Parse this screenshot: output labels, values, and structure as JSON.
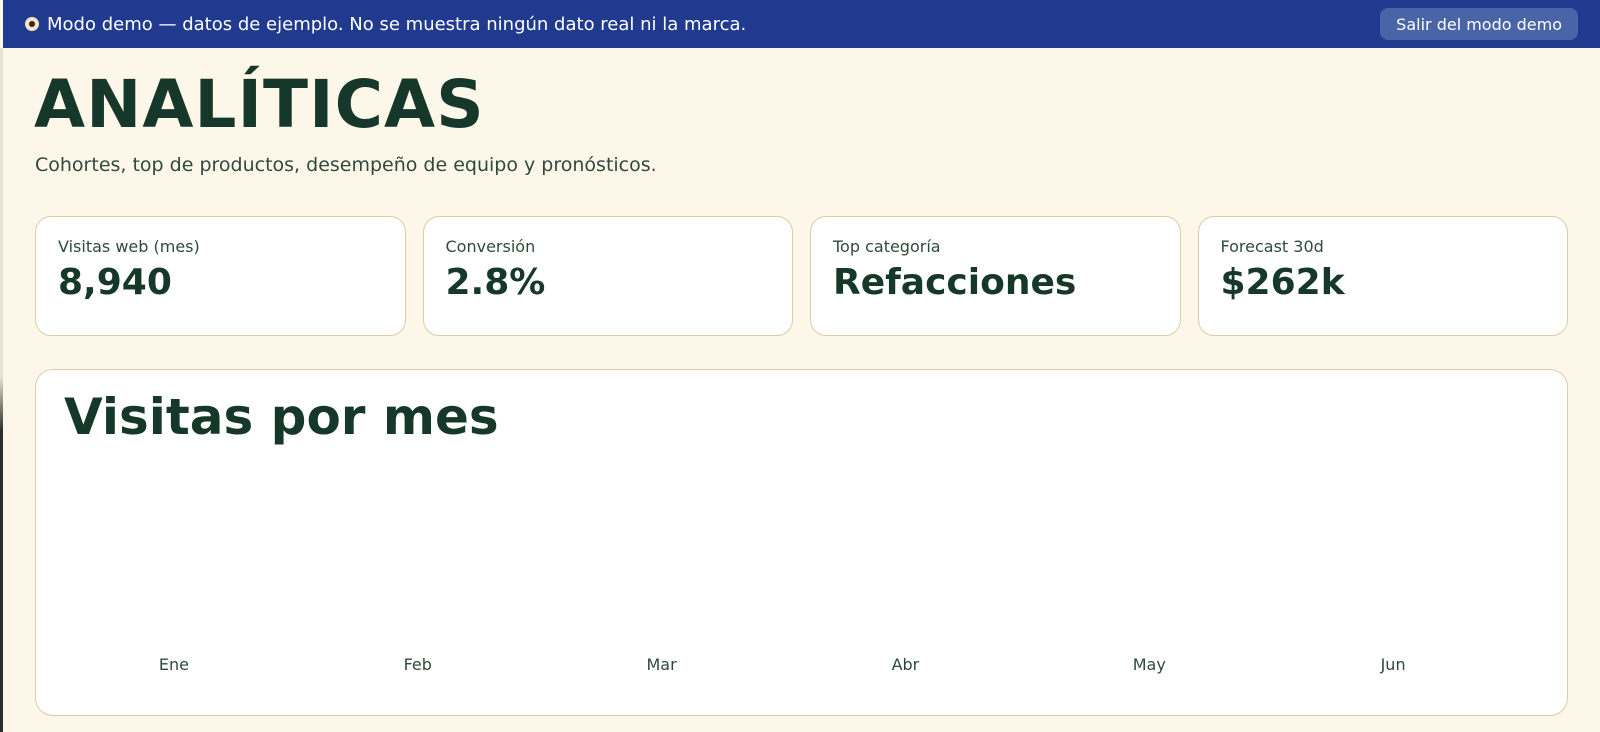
{
  "banner": {
    "text": "Modo demo — datos de ejemplo. No se muestra ningún dato real ni la marca.",
    "exit_label": "Salir del modo demo",
    "icon": "eye-icon",
    "background": "#1f3a8e"
  },
  "header": {
    "title": "ANALÍTICAS",
    "subtitle": "Cohortes, top de productos, desempeño de equipo y pronósticos."
  },
  "kpis": [
    {
      "label": "Visitas web (mes)",
      "value": "8,940"
    },
    {
      "label": "Conversión",
      "value": "2.8%"
    },
    {
      "label": "Top categoría",
      "value": "Refacciones"
    },
    {
      "label": "Forecast 30d",
      "value": "$262k"
    }
  ],
  "chart": {
    "title": "Visitas por mes"
  },
  "chart_data": {
    "type": "bar",
    "title": "Visitas por mes",
    "categories": [
      "Ene",
      "Feb",
      "Mar",
      "Abr",
      "May",
      "Jun"
    ],
    "values": [],
    "xlabel": "",
    "ylabel": "",
    "grid": false
  },
  "colors": {
    "background": "#fdf7ea",
    "banner": "#1f3a8e",
    "text_primary": "#16382a",
    "card_border": "#dccca8"
  }
}
